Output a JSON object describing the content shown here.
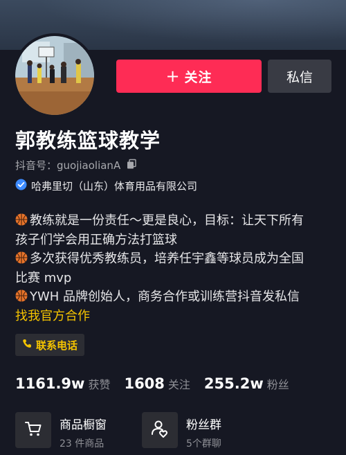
{
  "profile": {
    "name": "郭教练篮球教学",
    "douyin_id": "抖音号：guojiaolianA",
    "verification": "哈弗里切（山东）体育用品有限公司"
  },
  "actions": {
    "follow_plus": "+",
    "follow_label": "关注",
    "message_label": "私信"
  },
  "bio": {
    "line1": "教练就是一份责任～更是良心，目标：让天下所有",
    "line2": "孩子们学会用正确方法打篮球",
    "line3": "多次获得优秀教练员，培养任宇鑫等球员成为全国",
    "line4": "比赛 mvp",
    "line5": "YWH 品牌创始人，商务合作或训练营抖音发私信",
    "line6": "找我官方合作"
  },
  "contact": {
    "phone_label": "联系电话"
  },
  "stats": {
    "likes_count": "1161.9w",
    "likes_label": "获赞",
    "following_count": "1608",
    "following_label": "关注",
    "followers_count": "255.2w",
    "followers_label": "粉丝"
  },
  "shop": {
    "title": "商品橱窗",
    "subtitle": "23 件商品"
  },
  "fan_group": {
    "title": "粉丝群",
    "subtitle": "5个群聊"
  },
  "colors": {
    "background": "#161823",
    "follow_button": "#fe2c55",
    "message_button": "#393b44",
    "accent_yellow": "#f5c400",
    "verified_blue": "#3d8bff"
  },
  "icons": {
    "copy": "copy-icon",
    "verified": "verified-badge-icon",
    "basketball": "basketball-emoji-icon",
    "phone": "phone-icon",
    "shop": "shopping-cart-icon",
    "fan_group": "group-chat-icon"
  }
}
